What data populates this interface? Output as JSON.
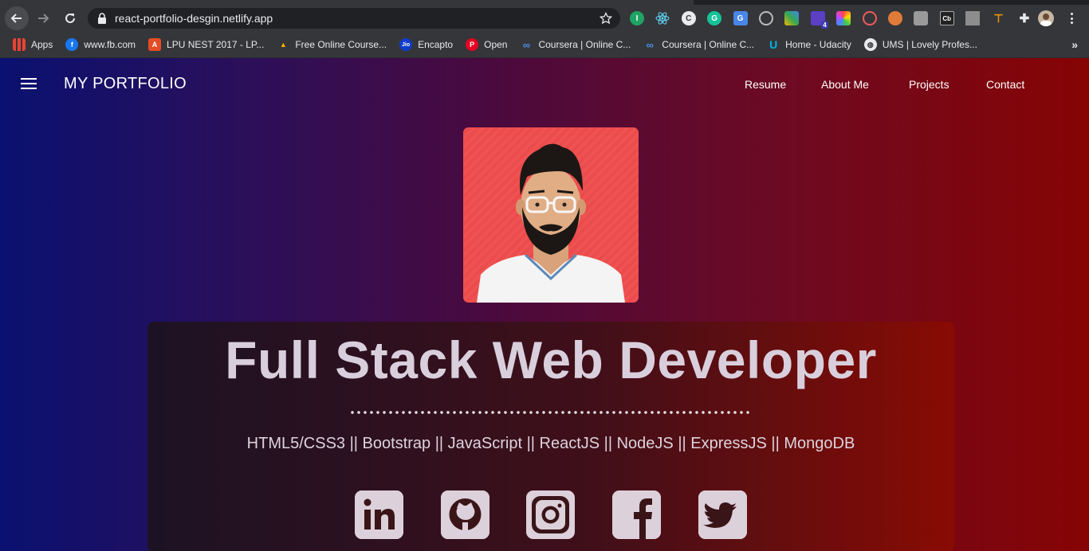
{
  "browser": {
    "url": "react-portfolio-desgin.netlify.app",
    "bookmarks": [
      {
        "label": "Apps",
        "icon": "apps-grid-icon"
      },
      {
        "label": "www.fb.com",
        "icon": "facebook-icon"
      },
      {
        "label": "LPU NEST 2017 - LP...",
        "icon": "lpu-icon"
      },
      {
        "label": "Free Online Course...",
        "icon": "triangle-logo-icon"
      },
      {
        "label": "Encapto",
        "icon": "jio-icon"
      },
      {
        "label": "Open",
        "icon": "pinterest-icon"
      },
      {
        "label": "Coursera | Online C...",
        "icon": "coursera-icon"
      },
      {
        "label": "Coursera | Online C...",
        "icon": "coursera-icon"
      },
      {
        "label": "Home - Udacity",
        "icon": "udacity-icon"
      },
      {
        "label": "UMS | Lovely Profes...",
        "icon": "globe-icon"
      }
    ],
    "more_bookmarks": "»",
    "extension_badge": "4"
  },
  "page": {
    "brand": "MY PORTFOLIO",
    "nav": [
      "Resume",
      "About Me",
      "Projects",
      "Contact"
    ],
    "hero_title": "Full Stack Web Developer",
    "skills": "HTML5/CSS3 || Bootstrap || JavaScript || ReactJS || NodeJS || ExpressJS || MongoDB",
    "social": [
      "linkedin-icon",
      "github-icon",
      "instagram-icon",
      "facebook-icon",
      "twitter-icon"
    ]
  },
  "colors": {
    "page_gradient": [
      "#0a1170",
      "#4a0a3e",
      "#860404"
    ],
    "profile_bg": "#ef4f4f",
    "social_icon": "#dcd0da",
    "title_text": "#d9cfdc"
  }
}
